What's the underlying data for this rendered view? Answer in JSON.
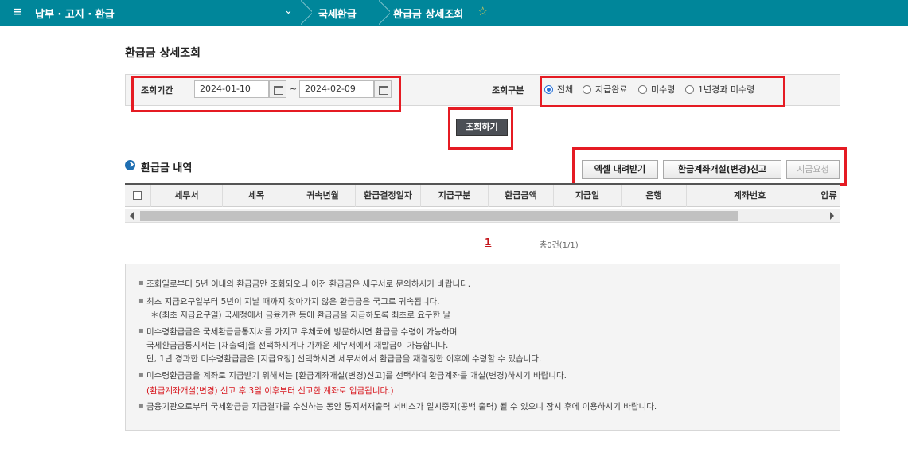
{
  "topbar": {
    "menu_icon": "≡",
    "crumb_main": "납부 · 고지 · 환급",
    "crumb_chevron": "⌄",
    "crumb_2": "국세환급",
    "crumb_3": "환급금 상세조회",
    "star_icon": "☆",
    "bg_color": "#00869a"
  },
  "page_title": "환급금 상세조회",
  "search": {
    "period_label": "조회기간",
    "start_date": "2024-01-10",
    "end_date": "2024-02-09",
    "tilde": "~",
    "type_label": "조회구분",
    "radios": [
      {
        "label": "전체",
        "checked": true
      },
      {
        "label": "지급완료",
        "checked": false
      },
      {
        "label": "미수령",
        "checked": false
      },
      {
        "label": "1년경과 미수령",
        "checked": false
      }
    ],
    "submit_label": "조회하기"
  },
  "section": {
    "title": "환급금 내역",
    "buttons": {
      "excel": "엑셀 내려받기",
      "account": "환급계좌개설(변경)신고",
      "request": "지급요청"
    }
  },
  "table": {
    "columns": [
      "세무서",
      "세목",
      "귀속년월",
      "환급결정일자",
      "지급구분",
      "환급금액",
      "지급일",
      "은행",
      "계좌번호",
      "압류"
    ],
    "rows": []
  },
  "pagination": {
    "current": "1",
    "total": "총0건(1/1)"
  },
  "notice": {
    "bullet": "▪",
    "lines": [
      {
        "text": "조회일로부터 5년 이내의 환급금만 조회되오니 이전 환급금은 세무서로 문의하시기 바랍니다.",
        "bullet": true
      },
      {
        "text": "최초 지급요구일부터 5년이 지날 때까지 찾아가지 않은 환급금은 국고로 귀속됩니다.",
        "bullet": true
      },
      {
        "text": "＊(최초 지급요구일) 국세청에서 금융기관 등에 환급금을 지급하도록 최초로 요구한 날",
        "bullet": false,
        "indent": true
      },
      {
        "text": "미수령환급금은 국세환급금통지서를 가지고 우체국에 방문하시면 환급금 수령이 가능하며",
        "bullet": true
      },
      {
        "text": "국세환급금통지서는 [재출력]을 선택하시거나 가까운 세무서에서 재발급이 가능합니다.",
        "bullet": false
      },
      {
        "text": "단, 1년 경과한 미수령환급금은 [지급요청] 선택하시면 세무서에서 환급금을 재결정한 이후에 수령할 수 있습니다.",
        "bullet": false
      },
      {
        "text": "미수령환급금을 계좌로 지급받기 위해서는 [환급계좌개설(변경)신고]를 선택하여 환급계좌를 개설(변경)하시기 바랍니다.",
        "bullet": true
      },
      {
        "text": "(환급계좌개설(변경) 신고 후 3일 이후부터 신고한 계좌로 입금됩니다.)",
        "bullet": false,
        "red": true
      },
      {
        "text": "금융기관으로부터 국세환급금 지급결과를 수신하는 동안 통지서재출력 서비스가 일시중지(공백 출력) 될 수 있으니 잠시 후에 이용하시기 바랍니다.",
        "bullet": true
      }
    ]
  },
  "colors": {
    "highlight": "#e51b23",
    "accent": "#00869a",
    "notice_red": "#d7161d"
  }
}
